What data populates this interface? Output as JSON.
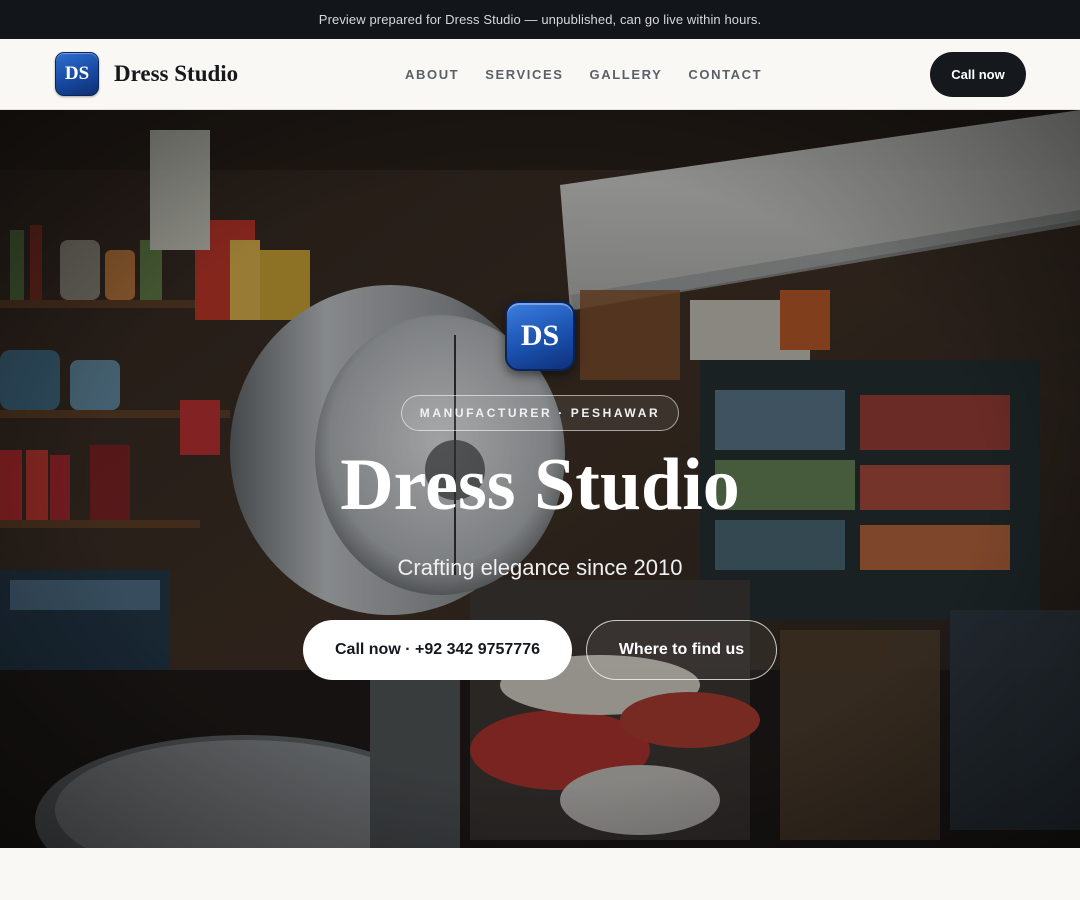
{
  "announcement": {
    "text": "Preview prepared for Dress Studio — unpublished, can go live within hours."
  },
  "header": {
    "logo_initials": "DS",
    "brand_name": "Dress Studio",
    "nav": [
      {
        "label": "ABOUT"
      },
      {
        "label": "SERVICES"
      },
      {
        "label": "GALLERY"
      },
      {
        "label": "CONTACT"
      }
    ],
    "cta_label": "Call now"
  },
  "hero": {
    "logo_initials": "DS",
    "tagline": "MANUFACTURER · PESHAWAR",
    "title": "Dress Studio",
    "subtitle": "Crafting elegance since 2010",
    "primary_button": "Call now · +92 342 9757776",
    "secondary_button": "Where to find us",
    "background_image": "shop-interior-with-scale-photo"
  },
  "colors": {
    "brand_blue": "#1b52b0",
    "dark": "#15181c",
    "page_bg": "#f9f8f5"
  }
}
